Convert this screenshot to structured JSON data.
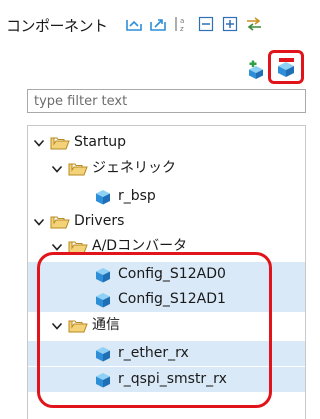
{
  "header": {
    "title": "コンポーネント",
    "toolbar": [
      {
        "icon": "collapse-pkg-icon"
      },
      {
        "icon": "expand-pkg-icon"
      },
      {
        "icon": "sort-alpha-icon"
      },
      {
        "icon": "collapse-all-icon"
      },
      {
        "icon": "expand-all-icon"
      },
      {
        "icon": "link-editor-icon"
      }
    ]
  },
  "actions": {
    "add_icon": "add-component-icon",
    "remove_icon": "remove-component-icon"
  },
  "filter": {
    "placeholder": "type filter text",
    "value": ""
  },
  "tree": {
    "startup": "Startup",
    "generic": "ジェネリック",
    "r_bsp": "r_bsp",
    "drivers": "Drivers",
    "adc": "A/Dコンバータ",
    "config0": "Config_S12AD0",
    "config1": "Config_S12AD1",
    "comm": "通信",
    "ether": "r_ether_rx",
    "qspi": "r_qspi_smstr_rx"
  },
  "colors": {
    "highlight": "#e0141a",
    "selection": "#d9e9f7",
    "folder": "#e8c25a",
    "cube": "#2e8fd8"
  }
}
